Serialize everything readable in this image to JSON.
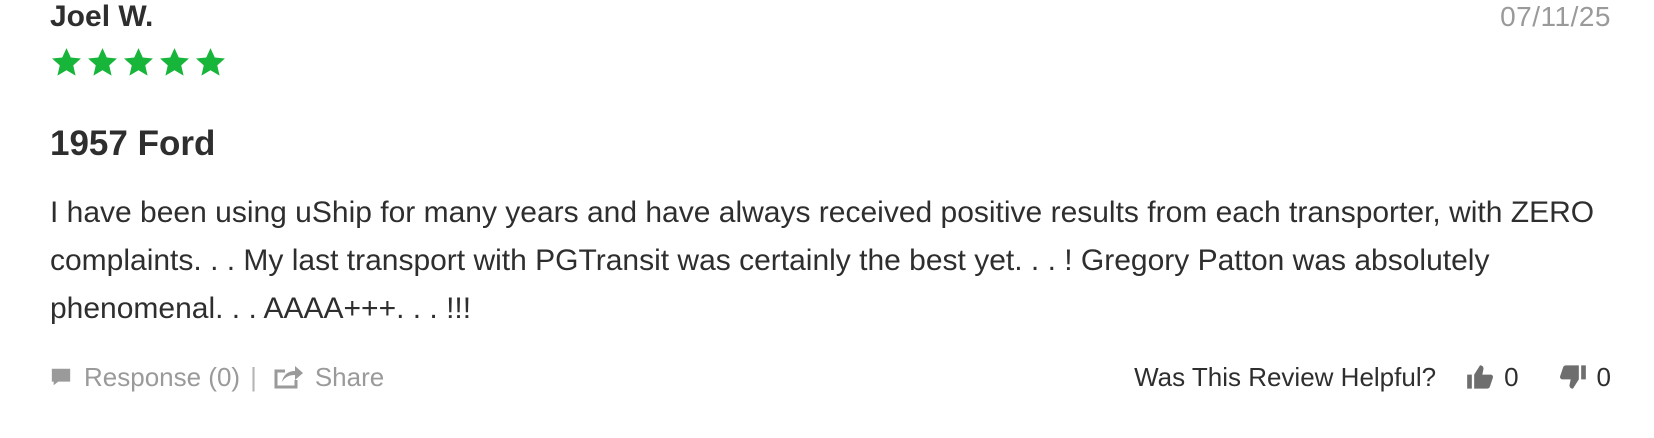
{
  "review": {
    "author": "Joel W.",
    "date": "07/11/25",
    "rating": 5,
    "rating_max": 5,
    "star_color": "#17b53a",
    "title": "1957 Ford",
    "body": "I have been using uShip for many years and have always received positive results from each transporter, with ZERO complaints. . . My last transport with PGTransit was certainly the best yet. . . ! Gregory Patton was absolutely phenomenal. . . AAAA+++. . . !!!"
  },
  "footer": {
    "response_label": "Response (0)",
    "separator": "|",
    "share_label": "Share",
    "helpful_question": "Was This Review Helpful?",
    "thumbs_up_count": "0",
    "thumbs_down_count": "0",
    "icons": {
      "response": "comment-icon",
      "share": "share-icon",
      "up": "thumbs-up-icon",
      "down": "thumbs-down-icon"
    }
  }
}
